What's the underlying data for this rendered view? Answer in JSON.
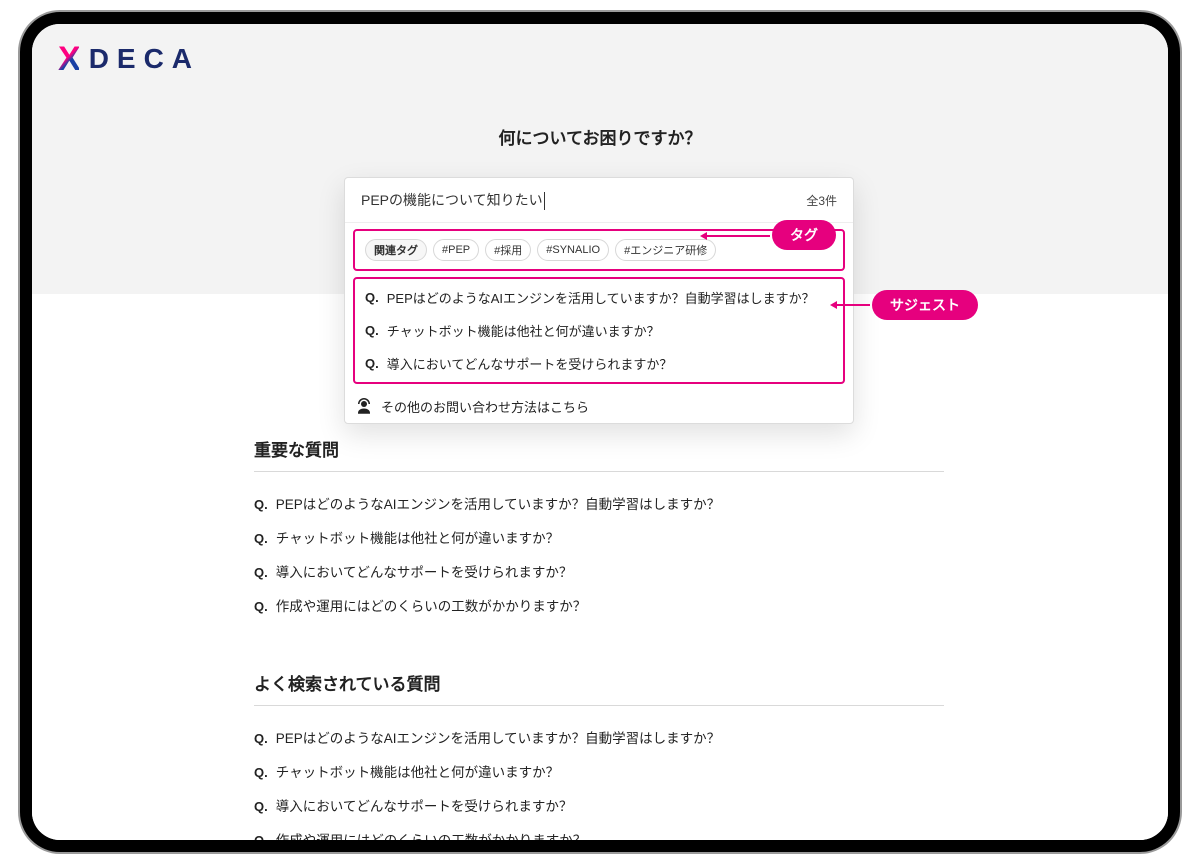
{
  "brand": {
    "name": "DECA"
  },
  "hero": {
    "title": "何についてお困りですか？"
  },
  "search": {
    "query": "PEPの機能について知りたい",
    "placeholder": "",
    "result_count": "全3件"
  },
  "tags": {
    "label": "関連タグ",
    "items": [
      "#PEP",
      "#採用",
      "#SYNALIO",
      "#エンジニア研修"
    ]
  },
  "suggestions": [
    "PEPはどのようなAIエンジンを活用していますか？自動学習はしますか？",
    "チャットボット機能は他社と何が違いますか？",
    "導入においてどんなサポートを受けられますか？"
  ],
  "other_contact": "その他のお問い合わせ方法はこちら",
  "callouts": {
    "tag": "タグ",
    "suggest": "サジェスト"
  },
  "sections": {
    "important": {
      "heading": "重要な質問",
      "items": [
        "PEPはどのようなAIエンジンを活用していますか？自動学習はしますか？",
        "チャットボット機能は他社と何が違いますか？",
        "導入においてどんなサポートを受けられますか？",
        "作成や運用にはどのくらいの工数がかかりますか？"
      ]
    },
    "popular": {
      "heading": "よく検索されている質問",
      "items": [
        "PEPはどのようなAIエンジンを活用していますか？自動学習はしますか？",
        "チャットボット機能は他社と何が違いますか？",
        "導入においてどんなサポートを受けられますか？",
        "作成や運用にはどのくらいの工数がかかりますか？"
      ]
    }
  },
  "q_prefix": "Q."
}
